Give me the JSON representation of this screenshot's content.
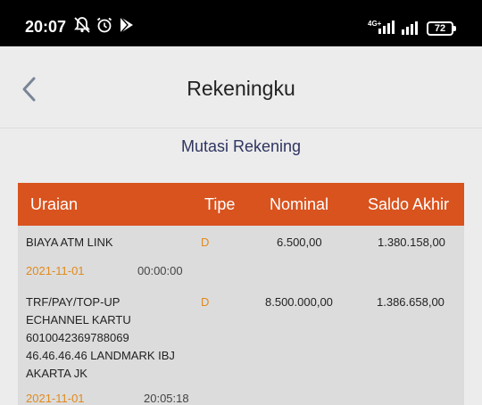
{
  "status_bar": {
    "time": "20:07",
    "network": "4G+",
    "battery": "72"
  },
  "header": {
    "title": "Rekeningku"
  },
  "section": {
    "title": "Mutasi Rekening"
  },
  "table": {
    "columns": [
      "Uraian",
      "Tipe",
      "Nominal",
      "Saldo Akhir"
    ],
    "rows": [
      {
        "uraian": "BIAYA ATM LINK",
        "tipe": "D",
        "nominal": "6.500,00",
        "saldo": "1.380.158,00",
        "date": "2021-11-01",
        "time": "00:00:00"
      },
      {
        "uraian_lines": [
          "TRF/PAY/TOP-UP",
          "ECHANNEL KARTU",
          "6010042369788069",
          "46.46.46.46 LANDMARK IBJ",
          "AKARTA JK"
        ],
        "tipe": "D",
        "nominal": "8.500.000,00",
        "saldo": "1.386.658,00",
        "date": "2021-11-01",
        "time": "20:05:18"
      }
    ]
  },
  "colors": {
    "accent": "#d9531e",
    "date": "#e08a1e",
    "title": "#2e3560"
  }
}
